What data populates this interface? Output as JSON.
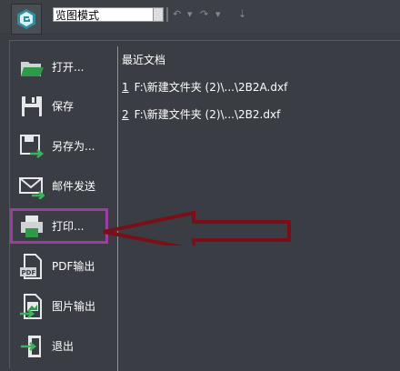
{
  "toolbar": {
    "app_icon": "app-logo-icon",
    "mode_select": {
      "value": "览图模式"
    },
    "quick_access": [
      "undo-icon",
      "chevron-down-icon",
      "redo-icon",
      "chevron-down-icon",
      "customize-icon"
    ]
  },
  "menu": {
    "items": [
      {
        "label": "打开...",
        "icon": "open-folder-icon"
      },
      {
        "label": "保存",
        "icon": "save-icon"
      },
      {
        "label": "另存为...",
        "icon": "save-as-icon"
      },
      {
        "label": "邮件发送",
        "icon": "mail-icon"
      },
      {
        "label": "打印...",
        "icon": "print-icon"
      },
      {
        "label": "PDF输出",
        "icon": "pdf-icon"
      },
      {
        "label": "图片输出",
        "icon": "image-export-icon"
      },
      {
        "label": "退出",
        "icon": "exit-icon"
      }
    ]
  },
  "recent": {
    "title": "最近文档",
    "files": [
      {
        "num": "1",
        "path": "F:\\新建文件夹 (2)\\...\\2B2A.dxf"
      },
      {
        "num": "2",
        "path": "F:\\新建文件夹 (2)\\...\\2B2.dxf"
      }
    ]
  },
  "annotations": {
    "highlight_color": "#9a3fa0",
    "arrow_color": "#7a0f18"
  }
}
